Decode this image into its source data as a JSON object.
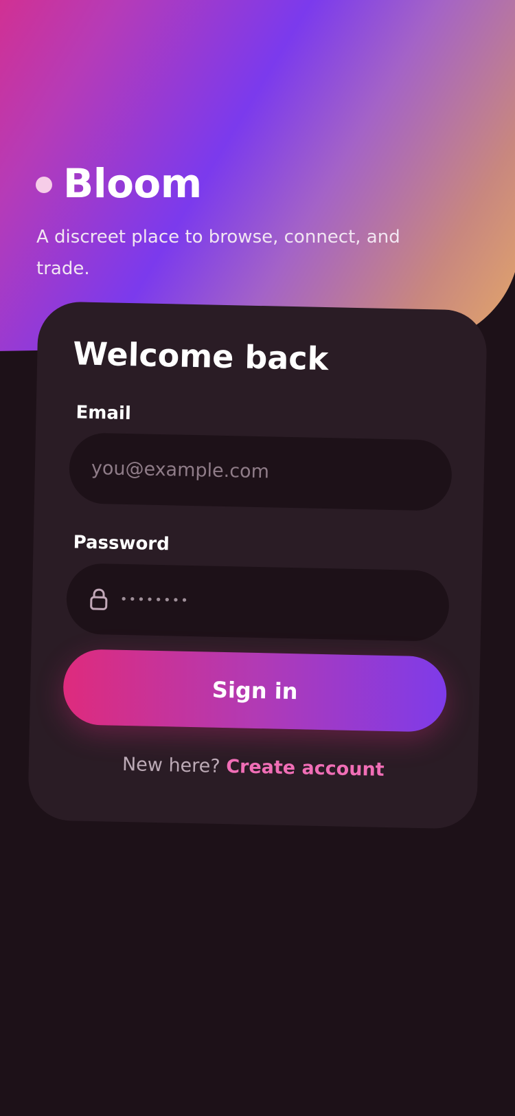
{
  "brand": {
    "name": "Bloom",
    "tagline": "A discreet place to browse, connect, and trade."
  },
  "login": {
    "title": "Welcome back",
    "email_label": "Email",
    "email_placeholder": "you@example.com",
    "password_label": "Password",
    "password_value": "••••••••",
    "signin_label": "Sign in",
    "signup_prompt": "New here?",
    "signup_link": "Create account"
  },
  "icons": {
    "brand_mark": "dot-icon",
    "password": "lock-icon"
  },
  "colors": {
    "background": "#1d1118",
    "card": "#2a1c25",
    "accent_pink": "#de2b7d",
    "accent_purple": "#7e3be9",
    "link": "#f06eb6"
  }
}
